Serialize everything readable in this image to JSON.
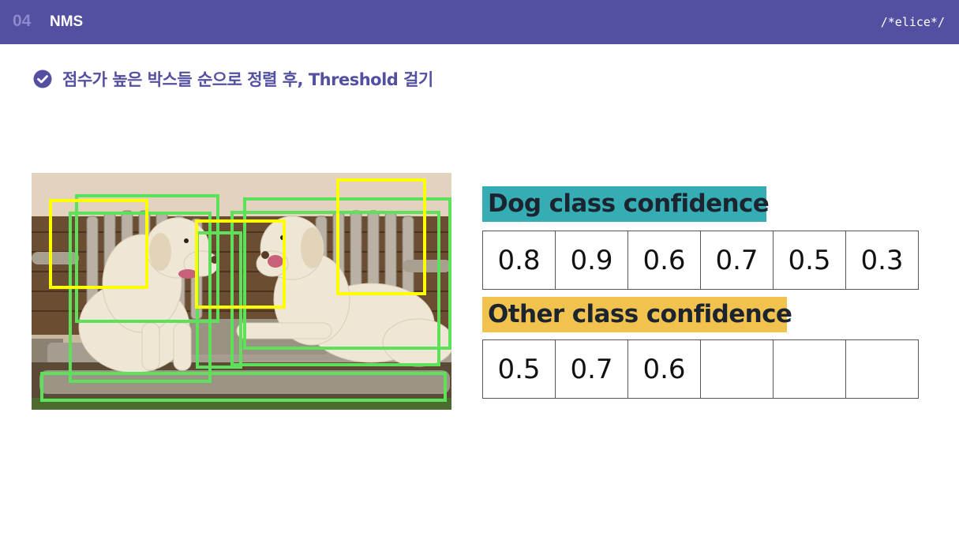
{
  "header": {
    "section_number": "04",
    "section_title": "NMS",
    "brand": "/*elice*/",
    "color": "#534fa1"
  },
  "bullet": {
    "icon": "check-circle-icon",
    "text": "점수가 높은 박스들 순으로 정렬 후, Threshold 걸기"
  },
  "image": {
    "subject": "two yellow labrador dogs on wooden bench",
    "box_colors": {
      "yellow": "#ffff00",
      "green": "#5fe05a"
    }
  },
  "dog_class": {
    "label": "Dog class confidence",
    "color": "#36adb5",
    "values": [
      "0.8",
      "0.9",
      "0.6",
      "0.7",
      "0.5",
      "0.3"
    ]
  },
  "other_class": {
    "label": "Other class confidence",
    "color": "#f2c24e",
    "values": [
      "0.5",
      "0.7",
      "0.6",
      "",
      "",
      ""
    ]
  }
}
